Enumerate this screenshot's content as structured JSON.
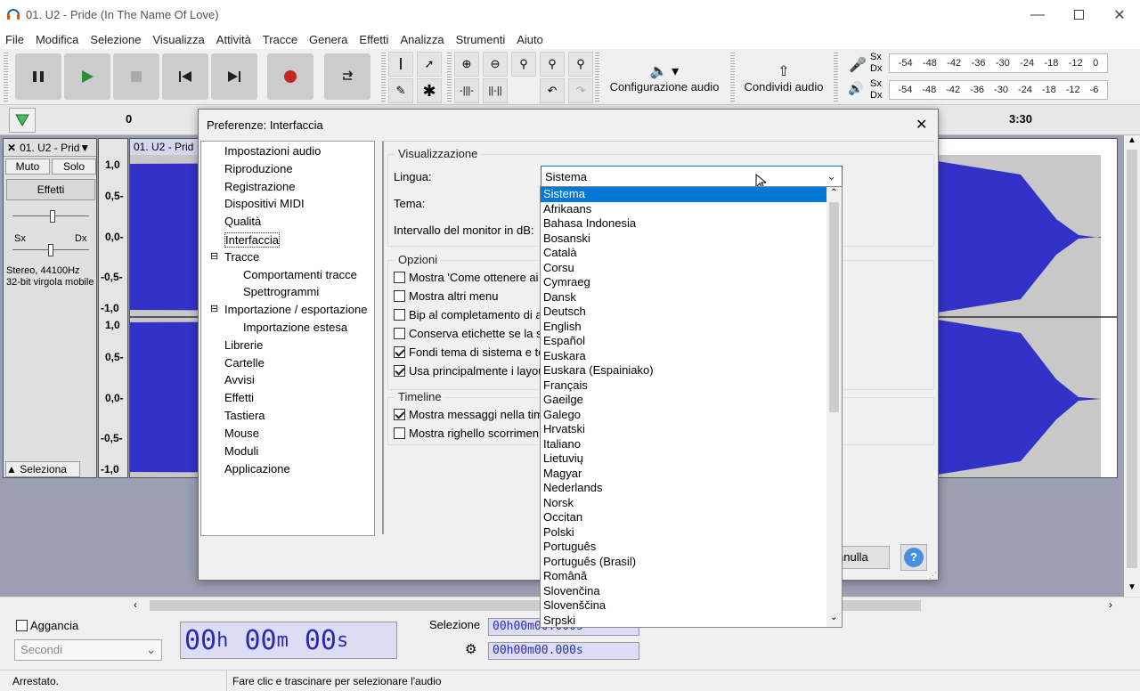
{
  "window": {
    "title": "01. U2 - Pride (In The Name Of Love)"
  },
  "menu": [
    "File",
    "Modifica",
    "Selezione",
    "Visualizza",
    "Attività",
    "Tracce",
    "Genera",
    "Effetti",
    "Analizza",
    "Strumenti",
    "Aiuto"
  ],
  "toolbar": {
    "audio_setup": "Configurazione audio",
    "share_audio": "Condividi audio"
  },
  "meters": {
    "rec": {
      "sx": "Sx",
      "dx": "Dx",
      "ticks": [
        "-54",
        "-48",
        "-42",
        "-36",
        "-30",
        "-24",
        "-18",
        "-12",
        "0"
      ]
    },
    "play": {
      "sx": "Sx",
      "dx": "Dx",
      "ticks": [
        "-54",
        "-48",
        "-42",
        "-36",
        "-30",
        "-24",
        "-18",
        "-12",
        "-6"
      ]
    }
  },
  "ruler": {
    "start": "0",
    "end": "3:30"
  },
  "track": {
    "name": "01. U2 - Prid",
    "clip_name": "01. U2 - Prid",
    "mute": "Muto",
    "solo": "Solo",
    "effects": "Effetti",
    "pan_left": "Sx",
    "pan_right": "Dx",
    "info1": "Stereo, 44100Hz",
    "info2": "32-bit virgola mobile",
    "select": "Seleziona",
    "scale_top": [
      "1,0",
      "0,5-",
      "0,0-",
      "-0,5-",
      "-1,0"
    ],
    "scale_bottom": [
      "1,0",
      "0,5-",
      "0,0-",
      "-0,5-",
      "-1,0"
    ]
  },
  "dialog": {
    "title": "Preferenze: Interfaccia",
    "cancel": "nnulla",
    "tree": [
      "Impostazioni audio",
      "Riproduzione",
      "Registrazione",
      "Dispositivi MIDI",
      "Qualità",
      "Interfaccia",
      "Tracce",
      "Comportamenti tracce",
      "Spettrogrammi",
      "Importazione / esportazione",
      "Importazione estesa",
      "Librerie",
      "Cartelle",
      "Avvisi",
      "Effetti",
      "Tastiera",
      "Mouse",
      "Moduli",
      "Applicazione"
    ],
    "display": {
      "group": "Visualizzazione",
      "language_label": "Lingua:",
      "language_value": "Sistema",
      "theme_label": "Tema:",
      "monitor_label": "Intervallo del monitor in dB:"
    },
    "options": {
      "group": "Opzioni",
      "items": [
        {
          "label": "Mostra 'Come ottenere ai",
          "checked": false
        },
        {
          "label": "Mostra altri menu",
          "checked": false
        },
        {
          "label": "Bip al completamento di a",
          "checked": false
        },
        {
          "label": "Conserva etichette se la se",
          "checked": false
        },
        {
          "label": "Fondi tema di sistema e te",
          "checked": true
        },
        {
          "label": "Usa principalmente i layou",
          "checked": true
        }
      ]
    },
    "timeline": {
      "group": "Timeline",
      "items": [
        {
          "label": "Mostra messaggi nella tim",
          "checked": true
        },
        {
          "label": "Mostra righello scorrimen",
          "checked": false
        }
      ]
    }
  },
  "languages": [
    "Sistema",
    "Afrikaans",
    "Bahasa Indonesia",
    "Bosanski",
    "Català",
    "Corsu",
    "Cymraeg",
    "Dansk",
    "Deutsch",
    "English",
    "Español",
    "Euskara",
    "Euskara (Espainiako)",
    "Français",
    "Gaeilge",
    "Galego",
    "Hrvatski",
    "Italiano",
    "Lietuvių",
    "Magyar",
    "Nederlands",
    "Norsk",
    "Occitan",
    "Polski",
    "Português",
    "Português (Brasil)",
    "Română",
    "Slovenčina",
    "Slovenščina",
    "Srpski"
  ],
  "bottom": {
    "snap": "Aggancia",
    "snap_unit": "Secondi",
    "time": {
      "h": "00",
      "hu": "h",
      "m": "00",
      "mu": "m",
      "s": "00",
      "su": "s"
    },
    "selection": "Selezione",
    "sel1": "00h00m00.000s",
    "sel2": "00h00m00.000s"
  },
  "status": {
    "state": "Arrestato.",
    "hint": "Fare clic e trascinare per selezionare l'audio"
  },
  "colors": {
    "wave": "#3232c8",
    "wave_bg": "#ffffff",
    "accent": "#0078d7"
  }
}
